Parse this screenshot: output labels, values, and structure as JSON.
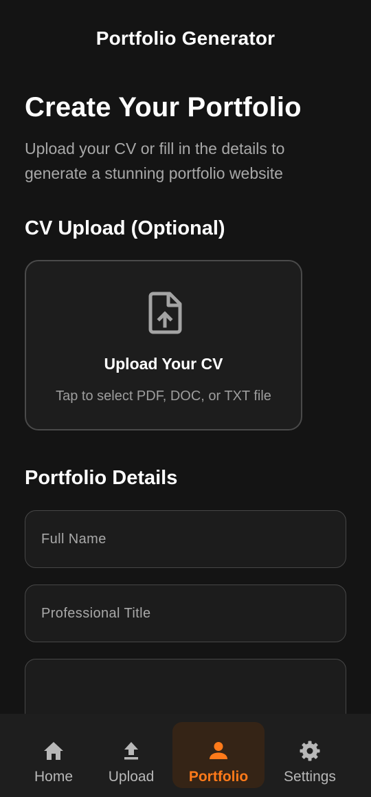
{
  "app_bar": {
    "title": "Portfolio Generator"
  },
  "main": {
    "title": "Create Your Portfolio",
    "subtitle": "Upload your CV or fill in the details to generate a stunning portfolio website"
  },
  "cv_upload": {
    "section_title": "CV Upload (Optional)",
    "icon": "file-upload-icon",
    "card_title": "Upload Your CV",
    "card_hint": "Tap to select PDF, DOC, or TXT file"
  },
  "details": {
    "section_title": "Portfolio Details",
    "full_name": {
      "placeholder": "Full Name",
      "value": ""
    },
    "professional_title": {
      "placeholder": "Professional Title",
      "value": ""
    },
    "bio": {
      "placeholder": "",
      "value": ""
    }
  },
  "bottom_nav": {
    "active": "portfolio",
    "accent_color": "#ff7a1a",
    "items": [
      {
        "id": "home",
        "label": "Home",
        "icon": "home-icon"
      },
      {
        "id": "upload",
        "label": "Upload",
        "icon": "upload-icon"
      },
      {
        "id": "portfolio",
        "label": "Portfolio",
        "icon": "person-icon"
      },
      {
        "id": "settings",
        "label": "Settings",
        "icon": "gear-icon"
      }
    ]
  }
}
